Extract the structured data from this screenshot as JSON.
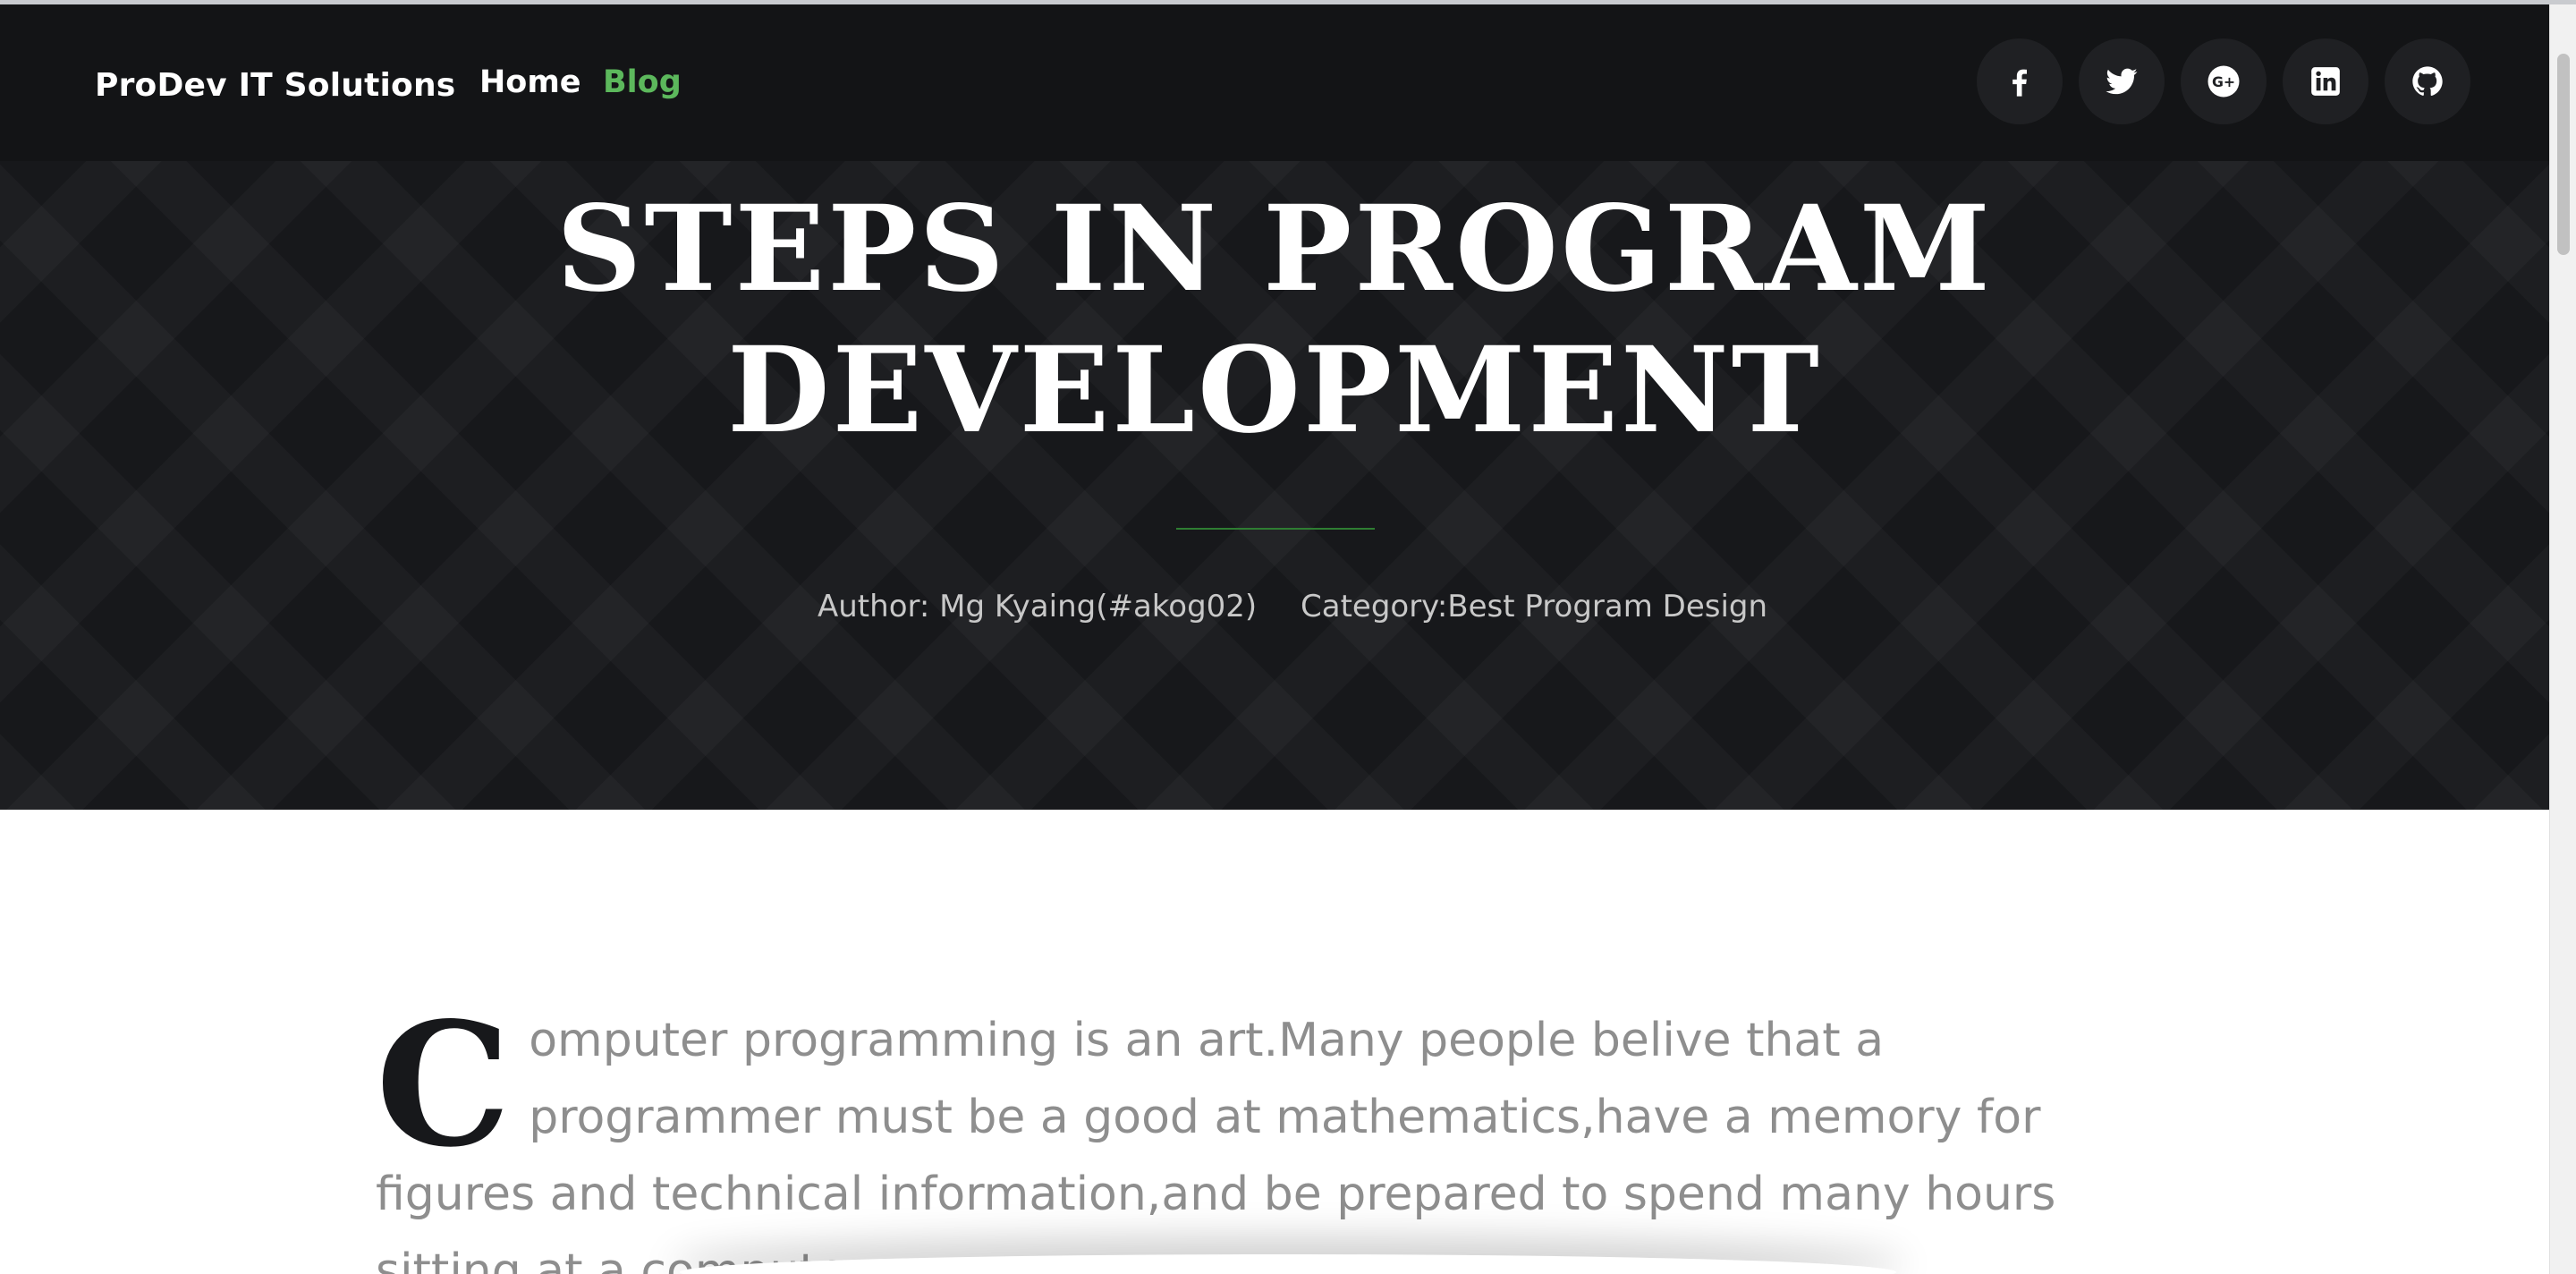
{
  "nav": {
    "brand": "ProDev IT Solutions",
    "links": [
      {
        "label": "Home",
        "active": false
      },
      {
        "label": "Blog",
        "active": true
      }
    ],
    "active_color": "#5cb85c",
    "social_icons": [
      "facebook-icon",
      "twitter-icon",
      "google-plus-icon",
      "linkedin-icon",
      "github-icon"
    ]
  },
  "hero": {
    "title_line1": "STEPS IN PROGRAM",
    "title_line2": "DEVELOPMENT",
    "author": "Author: Mg Kyaing(#akog02)",
    "category": "Category:Best Program Design",
    "divider_color": "#2e7d32",
    "background_color": "#17181b"
  },
  "article": {
    "drop_cap": "C",
    "body": "omputer programming is an art.Many people belive that a programmer must be a good at mathematics,have a memory for figures and technical information,and be prepared to spend many hours sitting at a computer."
  }
}
